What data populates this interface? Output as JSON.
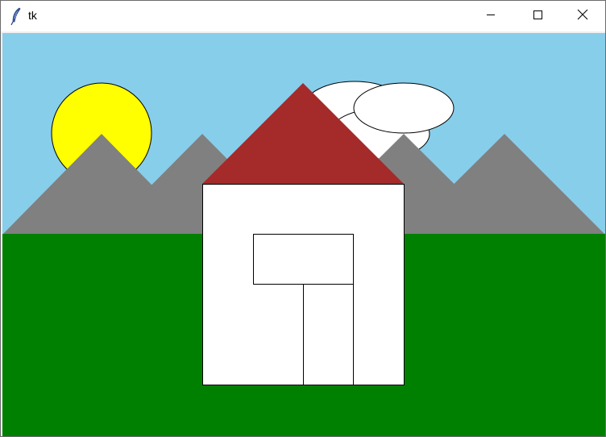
{
  "window": {
    "title": "tk",
    "icon": "feather-icon",
    "controls": {
      "minimize": "minimize-icon",
      "maximize": "maximize-icon",
      "close": "close-icon"
    }
  },
  "scene": {
    "colors": {
      "sky": "#87ceeb",
      "sun": "#ffff00",
      "mountains": "#808080",
      "cloud": "#ffffff",
      "grass": "#008000",
      "roof": "#a52a2a",
      "house": "#ffffff",
      "outline": "#000000"
    }
  }
}
